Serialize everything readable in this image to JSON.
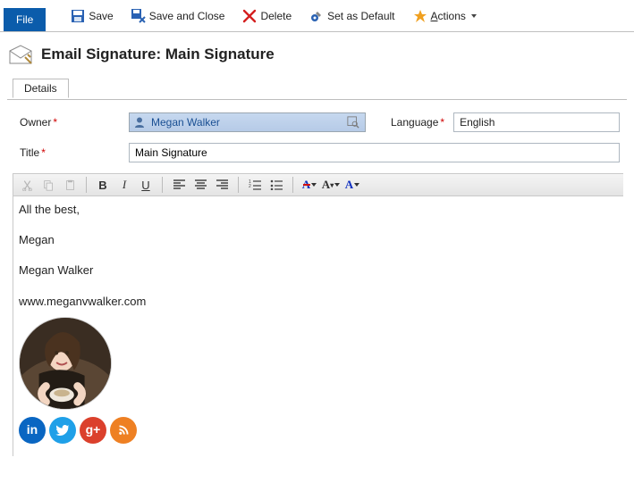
{
  "ribbon": {
    "file": "File",
    "save": "Save",
    "save_close": "Save and Close",
    "delete": "Delete",
    "set_default": "Set as Default",
    "actions": "ctions",
    "actions_prefix": "A"
  },
  "header": {
    "title": "Email Signature: Main Signature"
  },
  "tabs": {
    "details": "Details"
  },
  "form": {
    "owner_label": "Owner",
    "owner_value": "Megan Walker",
    "language_label": "Language",
    "language_value": "English",
    "title_label": "Title",
    "title_value": "Main Signature"
  },
  "signature": {
    "line1": "All the best,",
    "line2": "Megan",
    "line3": "Megan Walker",
    "line4": "www.meganvwalker.com"
  }
}
